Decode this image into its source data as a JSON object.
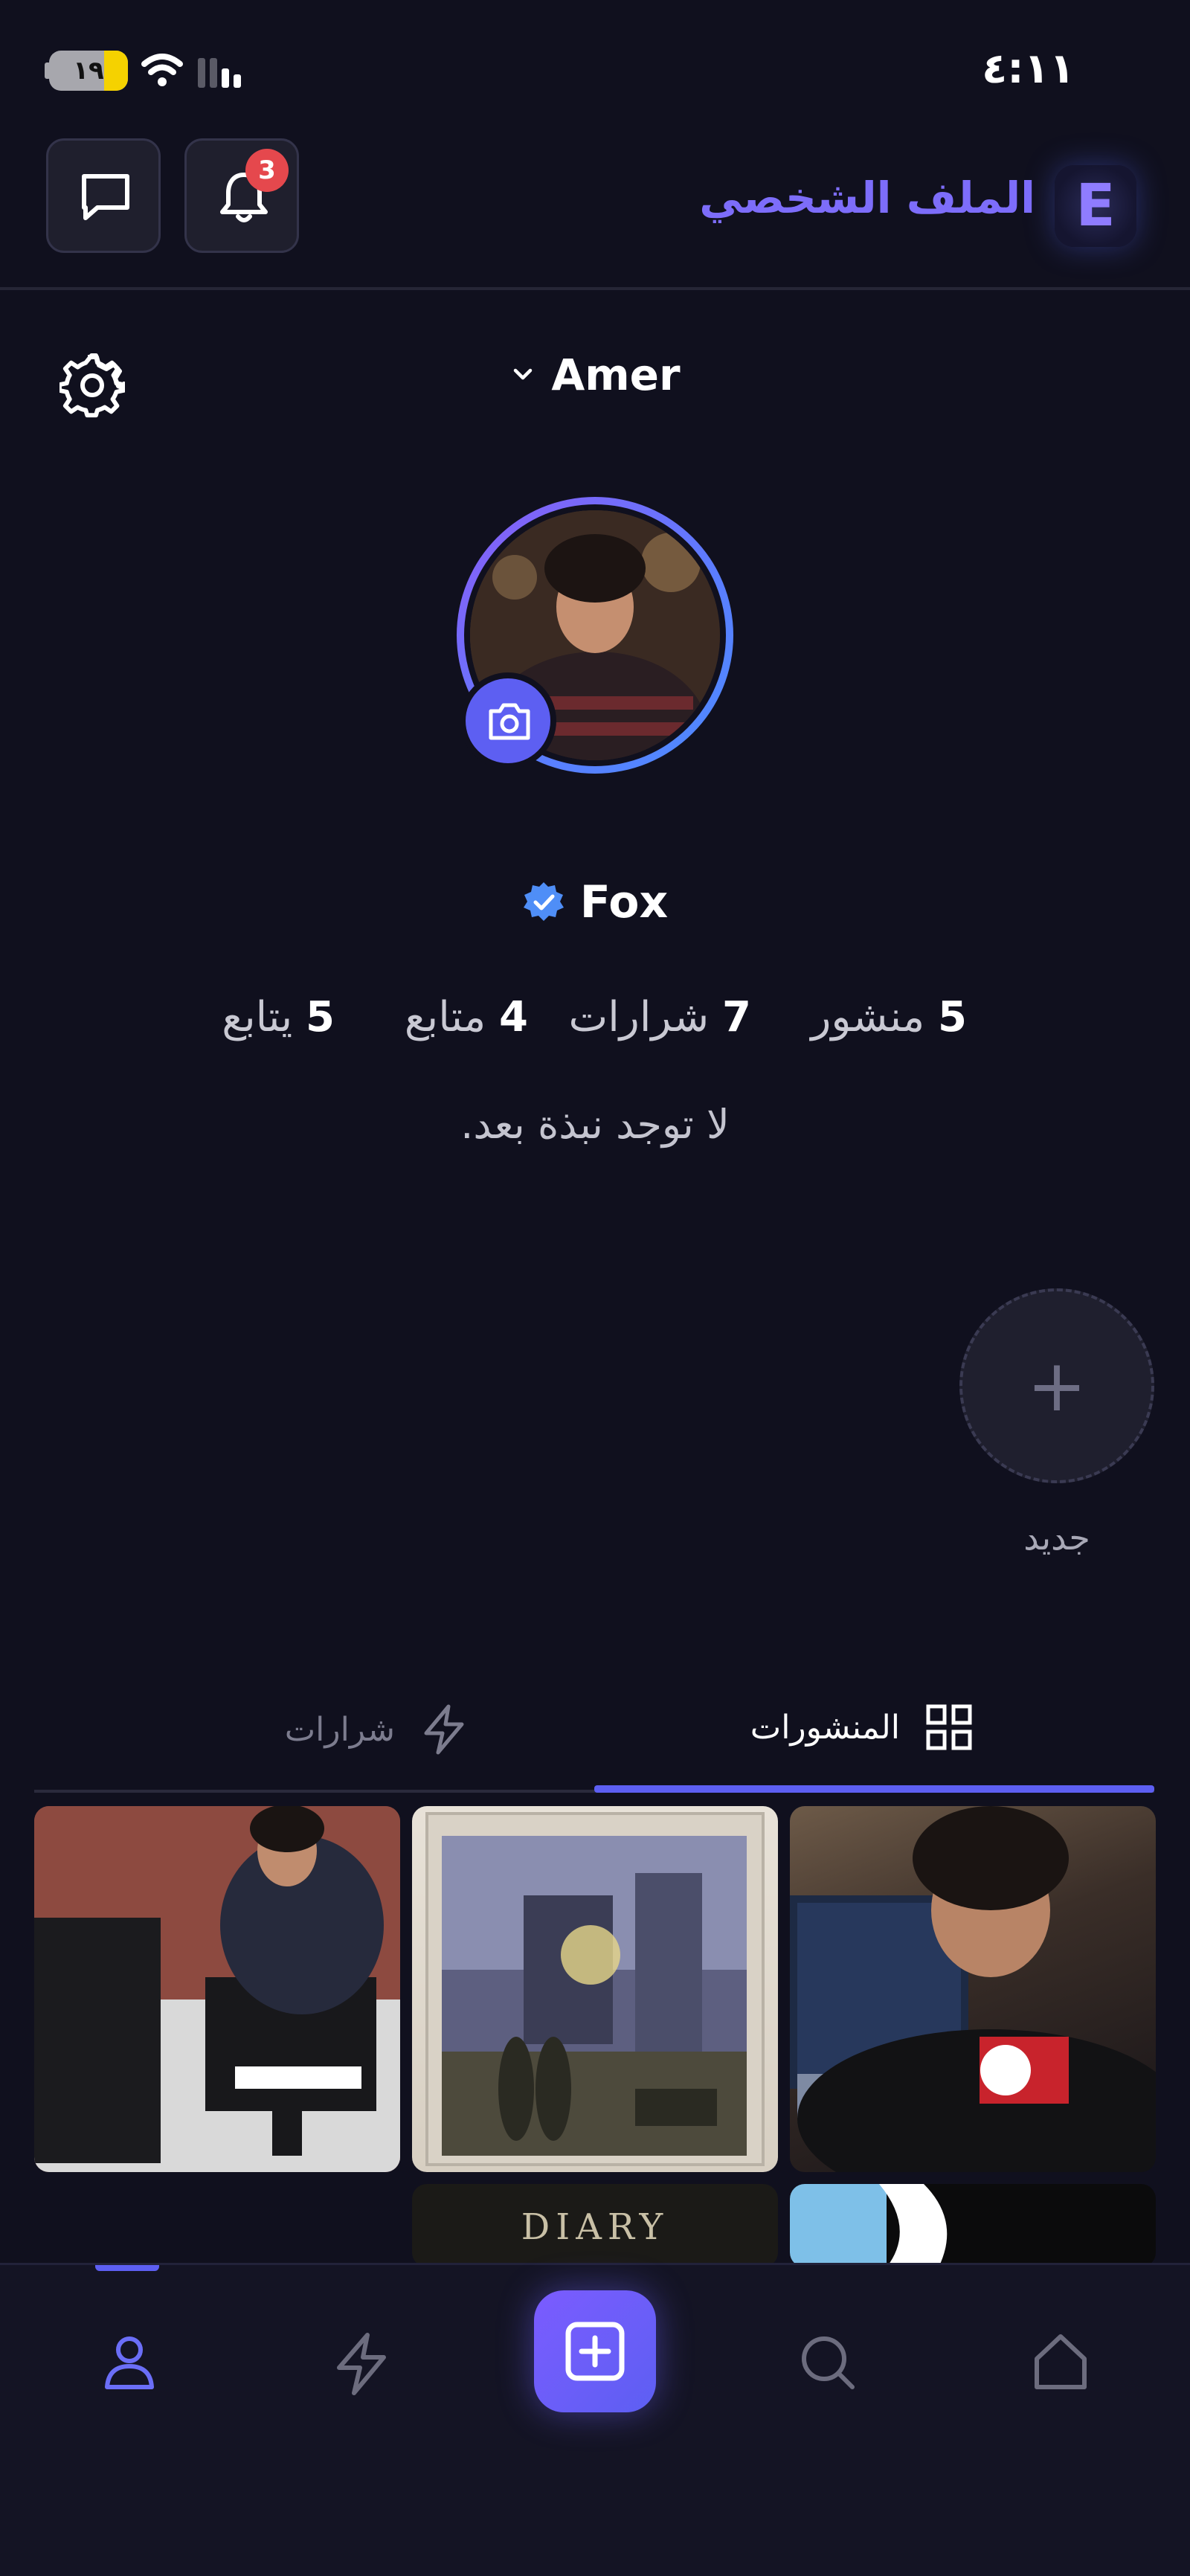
{
  "status_bar": {
    "time": "٤:١١",
    "battery": "١٩"
  },
  "header": {
    "title": "الملف الشخصي",
    "logo_letter": "E",
    "notification_count": "3"
  },
  "profile": {
    "username": "Amer",
    "display_name": "Fox",
    "stats": {
      "posts_count": "5",
      "posts_label": "منشور",
      "sparks_count": "7",
      "sparks_label": "شرارات",
      "followers_count": "4",
      "followers_label": "متابع",
      "following_count": "5",
      "following_label": "يتابع"
    },
    "bio": "لا توجد نبذة بعد."
  },
  "highlights": {
    "new_label": "جديد",
    "new_symbol": "+"
  },
  "tabs": {
    "posts_label": "المنشورات",
    "sparks_label": "شرارات"
  },
  "grid": {
    "diary_text": "DIARY"
  },
  "colors": {
    "accent": "#5d5ff2",
    "background": "#10101e",
    "badge": "#e5484d",
    "title": "#7d6dfa"
  }
}
